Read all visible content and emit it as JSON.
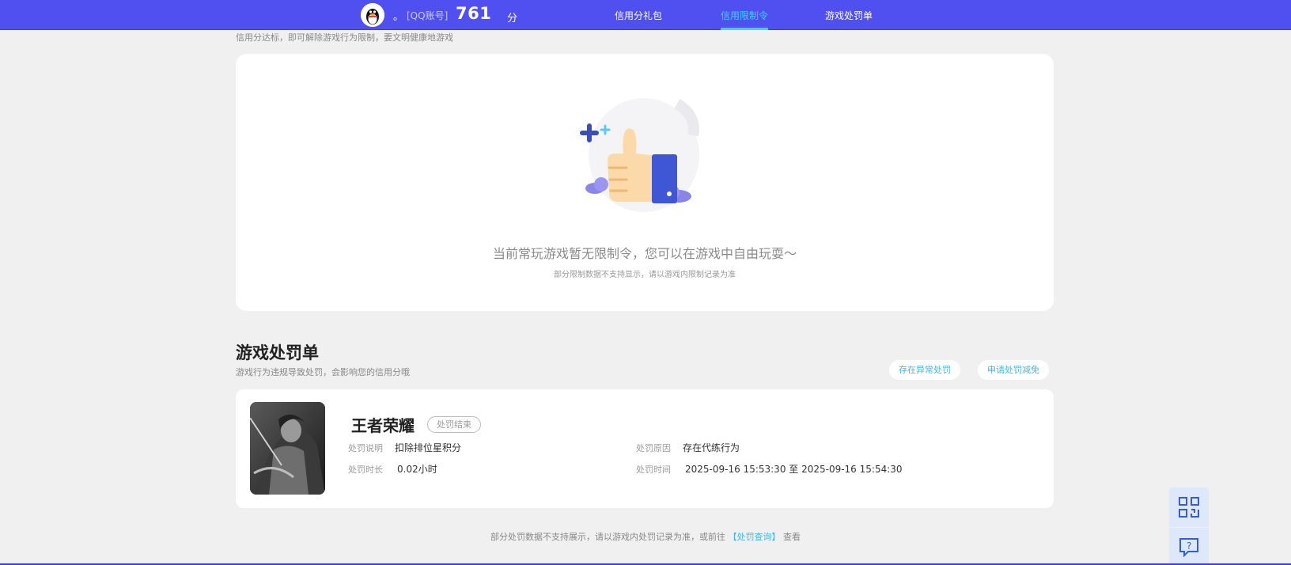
{
  "header": {
    "nickname": "。",
    "account_type": "[QQ账号]",
    "score": "761",
    "score_unit": "分",
    "nav": [
      {
        "label": "信用分礼包",
        "active": false
      },
      {
        "label": "信用限制令",
        "active": true
      },
      {
        "label": "游戏处罚单",
        "active": false
      }
    ],
    "colors": {
      "bar": "#5050f0",
      "active": "#34d7ff"
    }
  },
  "restriction": {
    "subtitle": "信用分达标，即可解除游戏行为限制，要文明健康地游戏",
    "empty_message": "当前常玩游戏暂无限制令，您可以在游戏中自由玩耍～",
    "empty_note": "部分限制数据不支持显示，请以游戏内限制记录为准",
    "illustration": "thumbs-up-icon"
  },
  "penalty": {
    "title": "游戏处罚单",
    "subtitle": "游戏行为违规导致处罚，会影响您的信用分哦",
    "buttons": {
      "abnormal": "存在异常处罚",
      "appeal": "申请处罚减免"
    },
    "item": {
      "game": "王者荣耀",
      "status": "处罚结束",
      "desc_label": "处罚说明",
      "desc_value": "扣除排位星积分",
      "reason_label": "处罚原因",
      "reason_value": "存在代练行为",
      "duration_label": "处罚时长",
      "duration_value": "0.02小时",
      "time_label": "处罚时间",
      "time_value": "2025-09-16 15:53:30 至 2025-09-16 15:54:30"
    }
  },
  "footer": {
    "prefix": "部分处罚数据不支持展示，请以游戏内处罚记录为准，或前往",
    "link": "【处罚查询】",
    "suffix": "查看"
  },
  "float": {
    "qr_icon": "qr-code-icon",
    "help_icon": "help-chat-icon"
  }
}
